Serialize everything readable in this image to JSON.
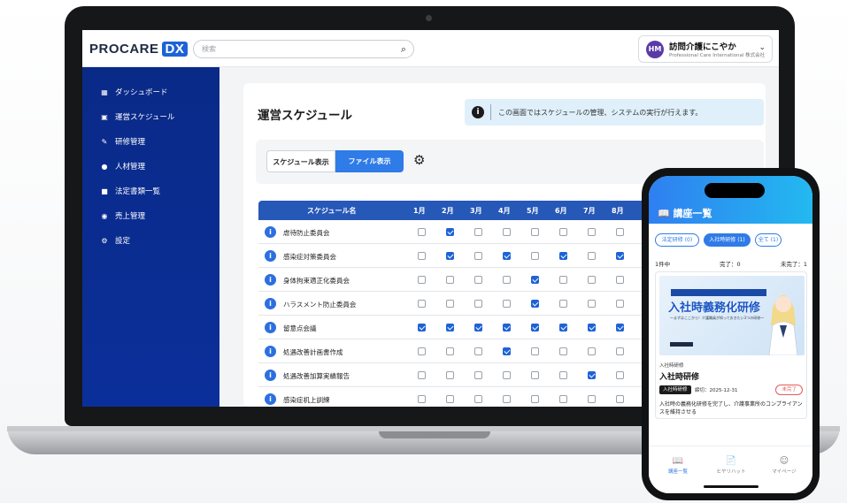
{
  "app": {
    "brand": "PROCARE",
    "brand_badge": "DX"
  },
  "search": {
    "placeholder": "検索"
  },
  "user": {
    "initials": "HM",
    "name": "訪問介護にこやか",
    "company": "Professional Care International 株式会社"
  },
  "sidebar": {
    "items": [
      {
        "label": "ダッシュボード",
        "icon": "grid-icon"
      },
      {
        "label": "運営スケジュール",
        "icon": "calendar-icon"
      },
      {
        "label": "研修管理",
        "icon": "pencil-icon"
      },
      {
        "label": "人材管理",
        "icon": "person-icon"
      },
      {
        "label": "法定書類一覧",
        "icon": "folder-icon"
      },
      {
        "label": "売上管理",
        "icon": "coin-icon"
      },
      {
        "label": "設定",
        "icon": "gear-icon"
      }
    ]
  },
  "main": {
    "title": "運営スケジュール",
    "info_text": "この画面ではスケジュールの管理、システムの実行が行えます。",
    "view_toggle": {
      "schedule_label": "スケジュール表示",
      "file_label": "ファイル表示",
      "active": "file"
    }
  },
  "table": {
    "header_name": "スケジュール名",
    "months": [
      "1月",
      "2月",
      "3月",
      "4月",
      "5月",
      "6月",
      "7月",
      "8月"
    ],
    "rows": [
      {
        "name": "虐待防止委員会",
        "checks": [
          false,
          true,
          false,
          false,
          false,
          false,
          false,
          false
        ]
      },
      {
        "name": "感染症対策委員会",
        "checks": [
          false,
          true,
          false,
          true,
          false,
          true,
          false,
          true
        ]
      },
      {
        "name": "身体拘束適正化委員会",
        "checks": [
          false,
          false,
          false,
          false,
          true,
          false,
          false,
          false
        ]
      },
      {
        "name": "ハラスメント防止委員会",
        "checks": [
          false,
          false,
          false,
          false,
          true,
          false,
          false,
          false
        ]
      },
      {
        "name": "留意点会議",
        "checks": [
          true,
          true,
          true,
          true,
          true,
          true,
          true,
          true
        ]
      },
      {
        "name": "処遇改善計画書作成",
        "checks": [
          false,
          false,
          false,
          true,
          false,
          false,
          false,
          false
        ]
      },
      {
        "name": "処遇改善加算実績報告",
        "checks": [
          false,
          false,
          false,
          false,
          false,
          false,
          true,
          false
        ]
      },
      {
        "name": "感染症机上訓練",
        "checks": [
          false,
          false,
          false,
          false,
          false,
          false,
          false,
          false
        ]
      }
    ]
  },
  "phone": {
    "title": "講座一覧",
    "chips": [
      {
        "label": "法定研修 (0)",
        "active": false
      },
      {
        "label": "入社時研修 (1)",
        "active": true
      },
      {
        "label": "全て (1)",
        "active": false
      }
    ],
    "stats": {
      "total": "1件中",
      "done": "完了：0",
      "pending": "未完了：1"
    },
    "card": {
      "banner_strip": "入社されたら方は3ヶ月以内に受講しておいてください",
      "banner_title": "入社時義務化研修",
      "banner_sub": "〜まずはここから！介護職員が知っておきたい3つの研修〜",
      "category": "入社時研修",
      "title": "入社時研修",
      "tag": "入社時研修",
      "deadline": "締切：2025-12-31",
      "status": "未完了",
      "description": "入社時の義務化研修を完了し、介護事業所のコンプライアンスを維持させる"
    },
    "tabs": [
      {
        "label": "講座一覧",
        "icon": "book-icon",
        "active": true
      },
      {
        "label": "ヒヤリハット",
        "icon": "document-icon",
        "active": false
      },
      {
        "label": "マイページ",
        "icon": "user-circle-icon",
        "active": false
      }
    ]
  },
  "colors": {
    "sidebar": "#0a2a88",
    "accent": "#2f7be8",
    "table_header": "#2658b8",
    "warning": "#e25b5b"
  }
}
